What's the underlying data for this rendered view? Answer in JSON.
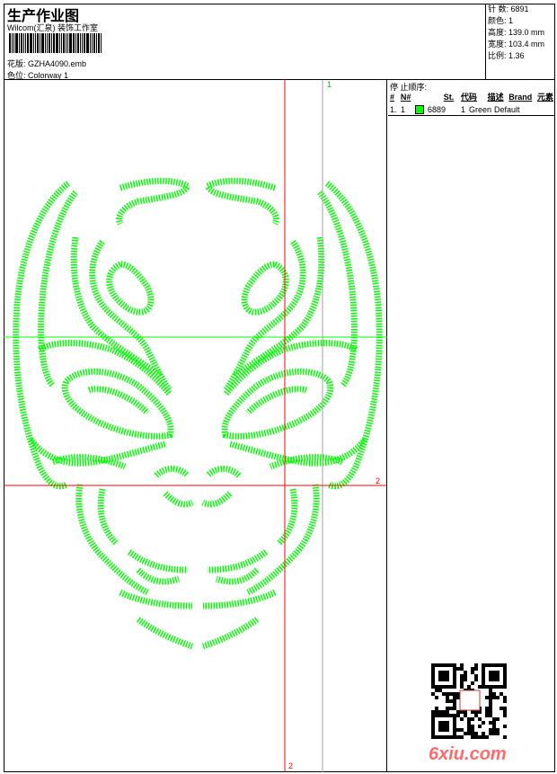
{
  "header": {
    "title": "生产作业图",
    "company": "Wilcom(汇泉) 装饰工作室",
    "design_label": "花版:",
    "design_value": "GZHA4090.emb",
    "colorway_label": "色位:",
    "colorway_value": "Colorway 1"
  },
  "info": {
    "stitches": "针 数: 6891",
    "colors": "颜色: 1",
    "height": "高度: 139.0 mm",
    "width": "宽度: 103.4 mm",
    "scale": "比例: 1.36"
  },
  "panel": {
    "title": "停 止顺序:",
    "columns": [
      "#",
      "N#",
      "St.",
      "代码",
      "描述",
      "Brand",
      "元素"
    ],
    "rows": [
      {
        "index": "1.",
        "n": "1",
        "color": "#00ff00",
        "stitches": "6889",
        "code": "1",
        "desc": "Green",
        "brand": "Default"
      }
    ]
  },
  "markers": {
    "green_label": "1",
    "red_h_label": "2",
    "red_v_label": "2"
  },
  "colors": {
    "thread": "#00ff00",
    "guide_red": "#ff0000",
    "guide_green": "#00ff00",
    "guide_gray": "#a0a0a0"
  },
  "watermark": "6xiu.com"
}
